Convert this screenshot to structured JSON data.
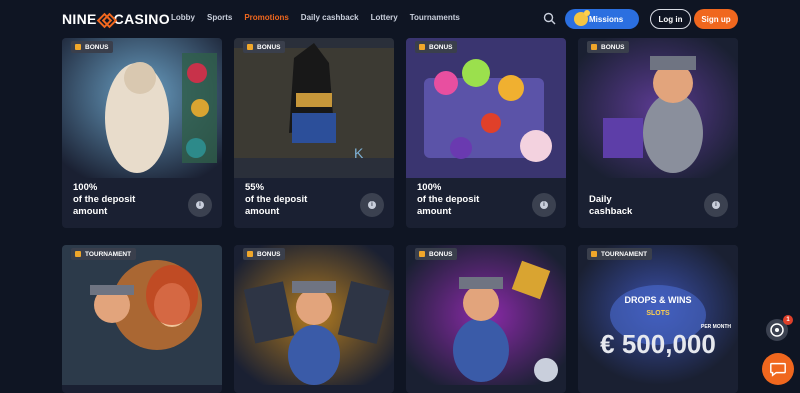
{
  "brand": {
    "name_left": "NINE",
    "name_right": "CASINO",
    "accent": "#f0671e"
  },
  "nav": {
    "items": [
      "Lobby",
      "Sports",
      "Promotions",
      "Daily cashback",
      "Lottery",
      "Tournaments"
    ],
    "active": "Promotions"
  },
  "header": {
    "missions_label": "Missions",
    "login_label": "Log in",
    "signup_label": "Sign up"
  },
  "cards": [
    {
      "badge": "BONUS",
      "lines": [
        "100%",
        "of the deposit",
        "amount"
      ],
      "art": "zeus-slot-art"
    },
    {
      "badge": "BONUS",
      "lines": [
        "55%",
        "of the deposit",
        "amount"
      ],
      "art": "anubis-slot-art"
    },
    {
      "badge": "BONUS",
      "lines": [
        "100%",
        "of the deposit",
        "amount"
      ],
      "art": "candy-slot-art"
    },
    {
      "badge": "BONUS",
      "lines": [
        "Daily",
        "cashback"
      ],
      "art": "mascot-gift-art"
    },
    {
      "badge": "TOURNAMENT",
      "lines": [],
      "art": "mascot-and-lady-art"
    },
    {
      "badge": "BONUS",
      "lines": [],
      "art": "mascot-cards-art"
    },
    {
      "badge": "BONUS",
      "lines": [],
      "art": "mascot-purple-art"
    },
    {
      "badge": "TOURNAMENT",
      "lines": [],
      "art": "drops-wins-art",
      "art_title": "DROPS & WINS",
      "art_sub": "SLOTS",
      "art_amount": "€ 500,000",
      "art_period": "PER MONTH"
    }
  ],
  "floating": {
    "badge_count": "1"
  }
}
